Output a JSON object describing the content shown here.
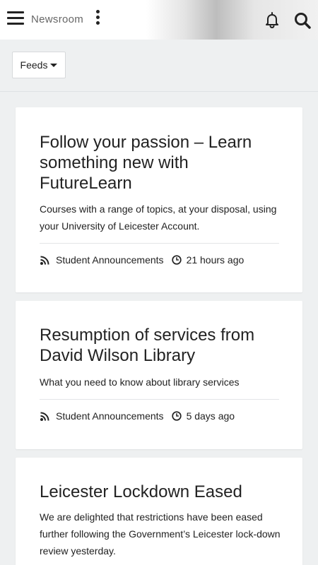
{
  "header": {
    "title": "Newsroom"
  },
  "filter": {
    "feeds_label": "Feeds"
  },
  "cards": [
    {
      "title": "Follow your passion – Learn something new with FutureLearn",
      "description": "Courses with a range of topics, at your disposal, using your University of Leicester Account.",
      "feed": "Student Announcements",
      "time": "21 hours ago"
    },
    {
      "title": "Resumption of services from David Wilson Library",
      "description": "What you need to know about library services",
      "feed": "Student Announcements",
      "time": "5 days ago"
    },
    {
      "title": "Leicester Lockdown Eased",
      "description": "We are delighted that restrictions have been eased further following the Government’s Leicester lock-down review yesterday."
    }
  ],
  "icons": [
    "hamburger-menu-icon",
    "more-vertical-icon",
    "bell-icon",
    "search-icon",
    "rss-icon",
    "clock-icon",
    "caret-down-icon"
  ]
}
